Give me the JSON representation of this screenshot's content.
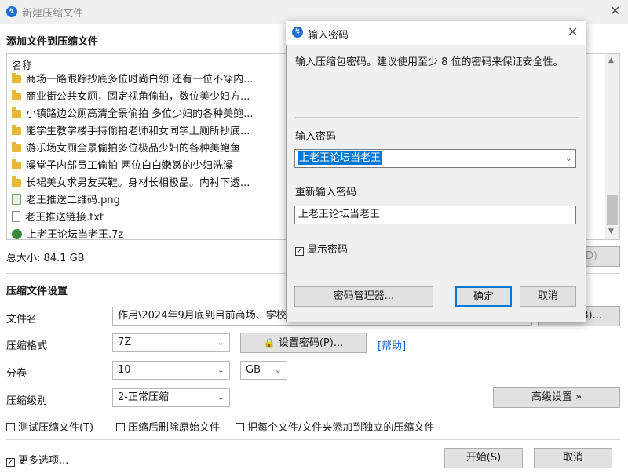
{
  "window": {
    "title": "新建压缩文件",
    "close": "✕"
  },
  "add_section": {
    "title": "添加文件到压缩文件",
    "column_name": "名称"
  },
  "files": [
    {
      "type": "folder",
      "name": "商场一路跟踪抄底多位时尚白领 还有一位不穿内..."
    },
    {
      "type": "folder",
      "name": "商业街公共女厕，固定视角偷拍，数位美少妇方..."
    },
    {
      "type": "folder",
      "name": "小镇路边公厕高清全景偷拍 多位少妇的各种美鲍..."
    },
    {
      "type": "folder",
      "name": "能学生教学楼手持偷拍老师和女同学上厕所抄底..."
    },
    {
      "type": "folder",
      "name": "游乐场女厕全景偷拍多位极品少妇的各种美鲍鱼"
    },
    {
      "type": "folder",
      "name": "澡堂子内部员工偷拍 两位白白嫩嫩的少妇洗澡"
    },
    {
      "type": "folder",
      "name": "长裙美女求男友买鞋。身材长相极品。内衬下透..."
    },
    {
      "type": "png",
      "name": "老王推送二维码.png"
    },
    {
      "type": "txt",
      "name": "老王推送链接.txt"
    },
    {
      "type": "7z",
      "name": "上老王论坛当老王.7z"
    }
  ],
  "total_size": "总大小: 84.1 GB",
  "delete_button_partial": "(D)",
  "settings": {
    "title": "压缩文件设置",
    "filename_label": "文件名",
    "filename_value": "作用\\2024年9月底到目前商场、学校、",
    "browse_button": "浏览(B)...",
    "browse_partial": "(B)...",
    "format_label": "压缩格式",
    "format_value": "7Z",
    "set_password_button": "设置密码(P)...",
    "help_link": "[帮助]",
    "volume_label": "分卷",
    "volume_value": "10",
    "volume_unit": "GB",
    "level_label": "压缩级别",
    "level_value": "2-正常压缩",
    "advanced_button": "高级设置 »",
    "test_checkbox": "测试压缩文件(T)",
    "delete_after_checkbox": "压缩后删除原始文件",
    "separate_checkbox": "把每个文件/文件夹添加到独立的压缩文件",
    "more_options": "更多选项...",
    "start_button": "开始(S)",
    "cancel_button": "取消"
  },
  "dialog": {
    "title": "输入密码",
    "description": "输入压缩包密码。建议使用至少 8 位的密码来保证安全性。",
    "enter_label": "输入密码",
    "enter_value": "上老王论坛当老王",
    "reenter_label": "重新输入密码",
    "reenter_value": "上老王论坛当老王",
    "show_password": "显示密码",
    "manager_button": "密码管理器...",
    "ok_button": "确定",
    "cancel_button": "取消"
  }
}
